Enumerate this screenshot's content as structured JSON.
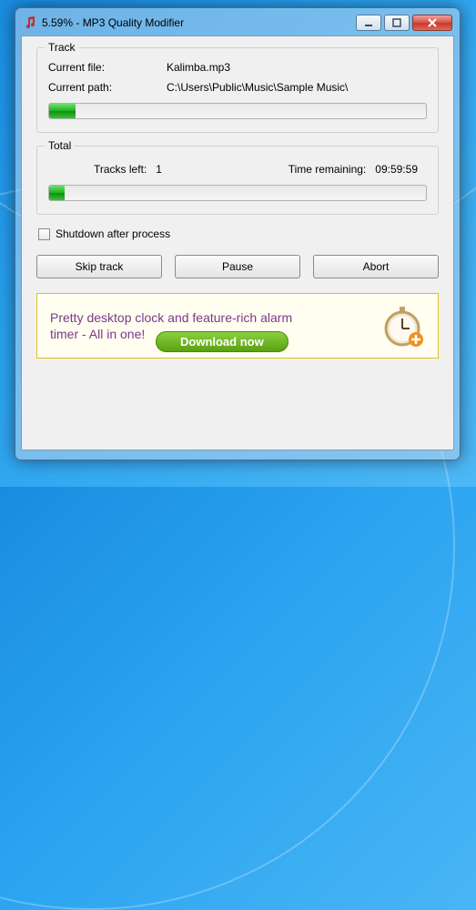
{
  "window": {
    "title": "5.59% - MP3 Quality Modifier"
  },
  "track": {
    "group_label": "Track",
    "current_file_label": "Current file:",
    "current_file_value": "Kalimba.mp3",
    "current_path_label": "Current path:",
    "current_path_value": "C:\\Users\\Public\\Music\\Sample Music\\",
    "progress_percent": 7
  },
  "total": {
    "group_label": "Total",
    "tracks_left_label": "Tracks left:",
    "tracks_left_value": "1",
    "time_remaining_label": "Time remaining:",
    "time_remaining_value": "09:59:59",
    "progress_percent": 4
  },
  "options": {
    "shutdown_label": "Shutdown after process",
    "shutdown_checked": false
  },
  "buttons": {
    "skip": "Skip track",
    "pause": "Pause",
    "abort": "Abort"
  },
  "ad": {
    "text": "Pretty desktop clock and feature-rich alarm timer - All in one!",
    "download_label": "Download now"
  }
}
